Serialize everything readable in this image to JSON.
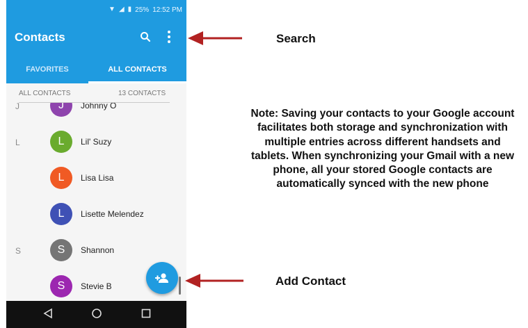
{
  "status_bar": {
    "battery": "25%",
    "time": "12:52 PM"
  },
  "app_bar": {
    "title": "Contacts",
    "icons": [
      "search-icon",
      "more-vert-icon"
    ]
  },
  "tabs": [
    {
      "label": "FAVORITES",
      "selected": false
    },
    {
      "label": "ALL CONTACTS",
      "selected": true
    }
  ],
  "list_header": {
    "left": "ALL CONTACTS",
    "right": "13 CONTACTS"
  },
  "contacts": [
    {
      "section": "J",
      "initial": "J",
      "name": "Johnny O",
      "color": "#8e44ad"
    },
    {
      "section": "L",
      "initial": "L",
      "name": "Lil' Suzy",
      "color": "#6aab2e"
    },
    {
      "section": "",
      "initial": "L",
      "name": "Lisa Lisa",
      "color": "#f05a24"
    },
    {
      "section": "",
      "initial": "L",
      "name": "Lisette Melendez",
      "color": "#3f51b5"
    },
    {
      "section": "S",
      "initial": "S",
      "name": "Shannon",
      "color": "#757575"
    },
    {
      "section": "",
      "initial": "S",
      "name": "Stevie B",
      "color": "#9c27b0"
    }
  ],
  "fab": {
    "icon": "add-contact-icon"
  },
  "nav_bar": {
    "icons": [
      "back-icon",
      "home-icon",
      "recents-icon"
    ]
  },
  "annotations": {
    "search_label": "Search",
    "add_contact_label": "Add Contact",
    "note": "Note: Saving your contacts to your Google account facilitates both storage and synchronization with multiple entries across different handsets and tablets. When synchronizing your Gmail with a new phone, all your stored Google contacts are automatically synced with the new phone"
  },
  "colors": {
    "accent": "#1f9be0",
    "arrow": "#b22222"
  }
}
